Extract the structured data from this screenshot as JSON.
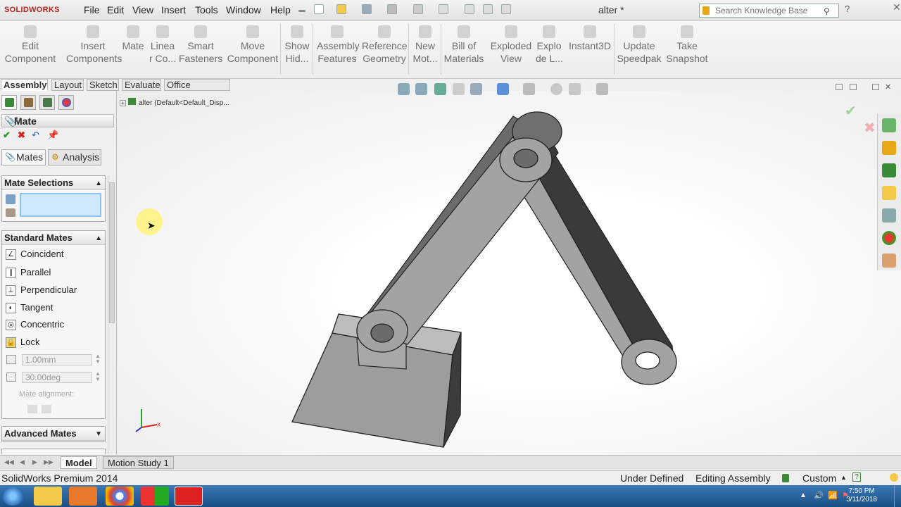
{
  "app": {
    "logo_text": "SOLIDWORKS",
    "menu": [
      "File",
      "Edit",
      "View",
      "Insert",
      "Tools",
      "Window",
      "Help"
    ],
    "doc_title": "alter *",
    "search_placeholder": "Search Knowledge Base"
  },
  "command_manager": {
    "buttons": [
      {
        "label": "Edit\nComponent",
        "icon": "edit-component-icon"
      },
      {
        "label": "Insert\nComponents",
        "icon": "insert-components-icon"
      },
      {
        "label": "Mate",
        "icon": "mate-icon"
      },
      {
        "label": "Linea\nr Co...",
        "icon": "linear-pattern-icon"
      },
      {
        "label": "Smart\nFasteners",
        "icon": "smart-fasteners-icon"
      },
      {
        "label": "Move\nComponent",
        "icon": "move-component-icon"
      },
      {
        "label": "Show\nHid...",
        "icon": "show-hidden-icon"
      },
      {
        "label": "Assembly\nFeatures",
        "icon": "assembly-features-icon"
      },
      {
        "label": "Reference\nGeometry",
        "icon": "reference-geometry-icon"
      },
      {
        "label": "New\nMot...",
        "icon": "new-motion-study-icon"
      },
      {
        "label": "Bill of\nMaterials",
        "icon": "bill-of-materials-icon"
      },
      {
        "label": "Exploded\nView",
        "icon": "exploded-view-icon"
      },
      {
        "label": "Explo\nde L...",
        "icon": "explode-line-icon"
      },
      {
        "label": "Instant3D",
        "icon": "instant3d-icon"
      },
      {
        "label": "Update\nSpeedpak",
        "icon": "update-speedpak-icon"
      },
      {
        "label": "Take\nSnapshot",
        "icon": "take-snapshot-icon"
      }
    ],
    "tabs": [
      "Assembly",
      "Layout",
      "Sketch",
      "Evaluate",
      "Office Products"
    ]
  },
  "property_manager": {
    "title": "Mate",
    "help": "?",
    "subtabs": [
      "Mates",
      "Analysis"
    ],
    "mate_selections": {
      "title": "Mate Selections",
      "value": ""
    },
    "standard_mates": {
      "title": "Standard Mates",
      "items": [
        "Coincident",
        "Parallel",
        "Perpendicular",
        "Tangent",
        "Concentric",
        "Lock"
      ],
      "icons": [
        "∠",
        "∥",
        "⊥",
        "◐",
        "◎",
        "🔒"
      ],
      "distance": "1.00mm",
      "angle": "30.00deg",
      "alignment_label": "Mate alignment:"
    },
    "advanced_mates": {
      "title": "Advanced Mates"
    }
  },
  "graphics": {
    "tree_label": "alter (Default<Default_Disp...",
    "triad_x": "X"
  },
  "bottom_tabs": [
    "Model",
    "Motion Study 1"
  ],
  "status": {
    "product": "SolidWorks Premium 2014",
    "defined": "Under Defined",
    "mode": "Editing Assembly",
    "units": "Custom"
  },
  "taskbar": {
    "time": "7:50 PM",
    "date": "3/11/2018"
  },
  "colors": {
    "part_fill": "#9a9a9a",
    "part_dark": "#555555",
    "accent_red": "#c0231c",
    "selection_box": "#cfe8fb",
    "taskbar": "#1b4f86"
  }
}
